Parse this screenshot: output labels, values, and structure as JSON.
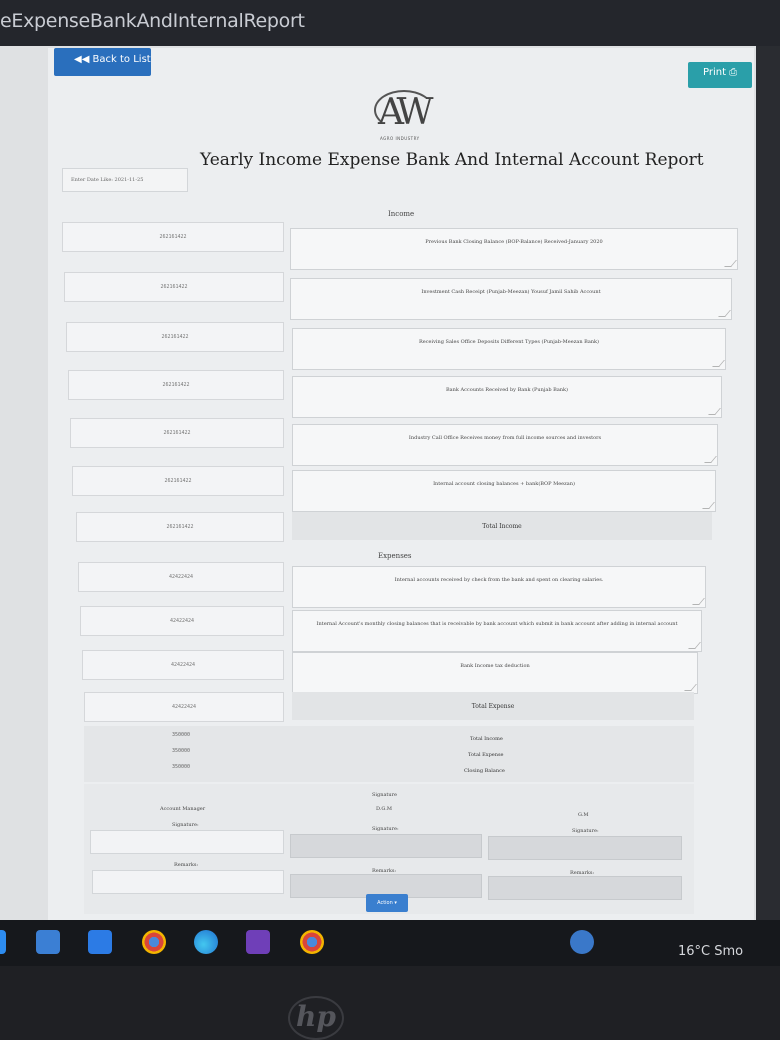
{
  "window": {
    "title": "eExpenseBankAndInternalReport"
  },
  "toolbar": {
    "back_label": "◀◀ Back to List",
    "print_label": "Print ⎙"
  },
  "logo": {
    "mark": "AW",
    "sub": "AGRO INDUSTRY"
  },
  "report": {
    "title": "Yearly Income Expense Bank And Internal Account Report",
    "date_label": "Enter Date Like: 2021-11-25"
  },
  "income": {
    "heading": "Income",
    "rows": [
      {
        "amount": "262161422",
        "description": "Previous Bank Closing Balance (BOP-Balance) Received-January 2020"
      },
      {
        "amount": "262161422",
        "description": "Investment Cash Receipt (Punjab-Meezan) Yousuf Jamil Sahib Account"
      },
      {
        "amount": "262161422",
        "description": "Receiving Sales Office Deposits Different Types (Punjab-Meezan Bank)"
      },
      {
        "amount": "262161422",
        "description": "Bank Accounts Received by Bank (Punjab Bank)"
      },
      {
        "amount": "262161422",
        "description": "Industry Call Office Receives money from full income sources and investors"
      },
      {
        "amount": "262161422",
        "description": "Internal account closing balances + bank(BOP Meezan)"
      }
    ],
    "total_amount": "262161422",
    "total_label": "Total Income"
  },
  "expenses": {
    "heading": "Expenses",
    "rows": [
      {
        "amount": "42422424",
        "description": "Internal accounts received by check from the bank and spent on clearing salaries."
      },
      {
        "amount": "42422424",
        "description": "Internal Account's monthly closing balances that is receivable by bank account which submit in bank account after adding in internal account"
      },
      {
        "amount": "42422424",
        "description": "Bank Income tax deduction"
      }
    ],
    "total_amount": "42422424",
    "total_label": "Total Expense"
  },
  "summary": {
    "values": [
      "350000",
      "350000",
      "350000"
    ],
    "labels": [
      "Total Income",
      "Total Expense",
      "Closing Balance"
    ]
  },
  "signatures": {
    "heading": "Signature",
    "columns": [
      "Account Manager",
      "D.G.M",
      "G.M"
    ],
    "signature_label": "Signature:",
    "remarks_label": "Remarks:"
  },
  "action_label": "Action ▾",
  "taskbar": {
    "weather": "16°C Smo"
  }
}
